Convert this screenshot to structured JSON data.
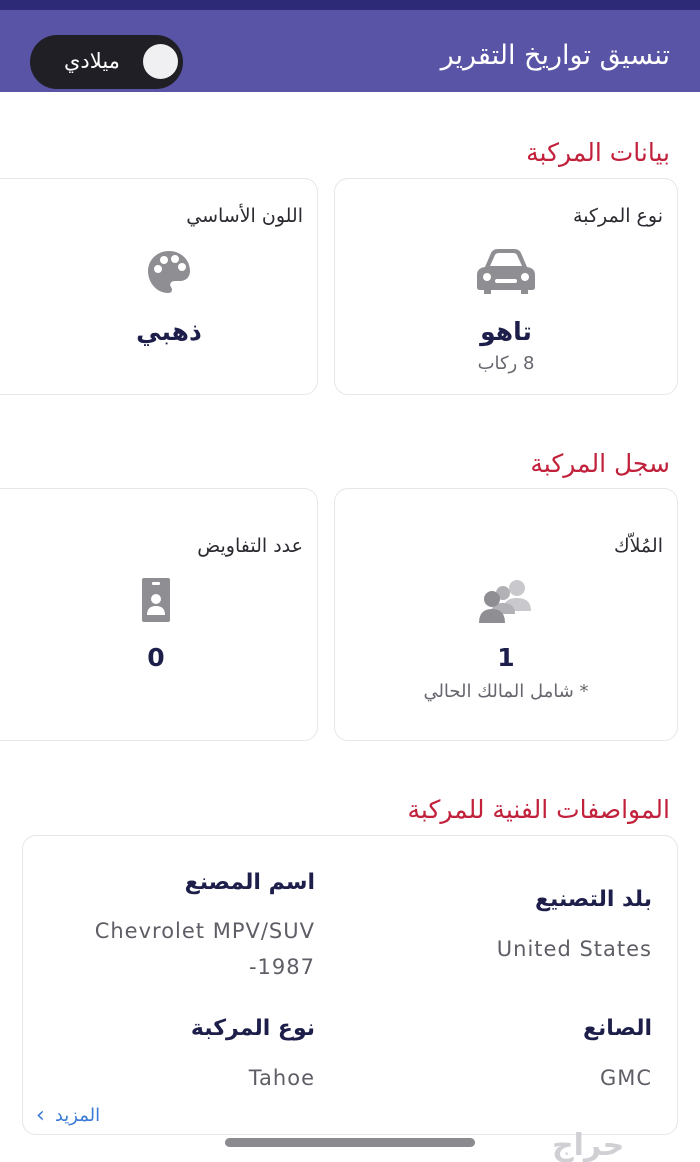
{
  "header": {
    "title": "تنسيق تواريخ التقرير",
    "toggle_label": "ميلادي",
    "toggle_on": false
  },
  "vehicle_data": {
    "title": "بيانات المركبة",
    "type_card": {
      "label": "نوع المركبة",
      "icon": "car-icon",
      "value": "تاهو",
      "sub": "8 ركاب"
    },
    "color_card": {
      "label": "اللون الأساسي",
      "icon": "palette-icon",
      "value": "ذهبي"
    }
  },
  "vehicle_record": {
    "title": "سجل المركبة",
    "owners_card": {
      "label": "المُلاّك",
      "icon": "people-icon",
      "value": "1",
      "sub": "* شامل المالك الحالي"
    },
    "mandates_card": {
      "label": "عدد التفاويض",
      "icon": "id-badge-icon",
      "value": "0"
    }
  },
  "specs": {
    "title": "المواصفات الفنية للمركبة",
    "country_label": "بلد التصنيع",
    "country_value": "United States",
    "manufacturer_name_label": "اسم المصنع",
    "manufacturer_name_line1": "Chevrolet MPV/SUV",
    "manufacturer_name_line2": "-1987",
    "maker_label": "الصانع",
    "maker_value": "GMC",
    "type_label": "نوع المركبة",
    "type_value": "Tahoe",
    "more_label": "المزيد"
  },
  "watermark": "حراج",
  "colors": {
    "header_bg": "#5a54a6",
    "section_title": "#c2213c",
    "value_text": "#1d1f4a",
    "link": "#3b7bd6"
  }
}
